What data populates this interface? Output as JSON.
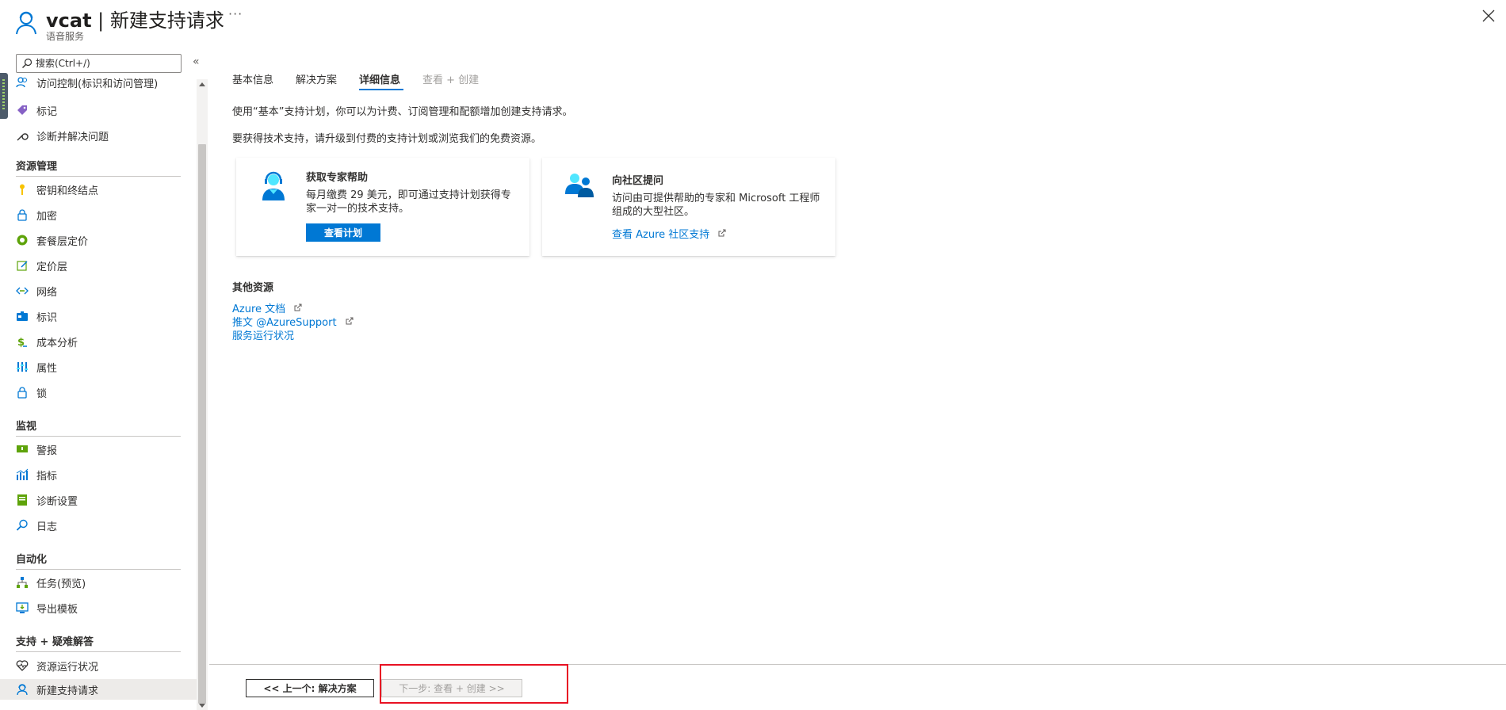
{
  "header": {
    "title_bold": "vcat",
    "title_rest": " | 新建支持请求",
    "subtitle": "语音服务",
    "more": "···"
  },
  "sidebar": {
    "search_placeholder": "搜索(Ctrl+/)",
    "collapse": "«",
    "items_top": [
      {
        "label": "访问控制(标识和访问管理)",
        "icon": "people-icon"
      },
      {
        "label": "标记",
        "icon": "tag-icon"
      },
      {
        "label": "诊断并解决问题",
        "icon": "wrench-icon"
      }
    ],
    "sections": [
      {
        "title": "资源管理",
        "items": [
          {
            "label": "密钥和终结点",
            "icon": "key-icon"
          },
          {
            "label": "加密",
            "icon": "lock-icon"
          },
          {
            "label": "套餐层定价",
            "icon": "pricing-icon"
          },
          {
            "label": "定价层",
            "icon": "edit-pricing-icon"
          },
          {
            "label": "网络",
            "icon": "network-icon"
          },
          {
            "label": "标识",
            "icon": "identity-icon"
          },
          {
            "label": "成本分析",
            "icon": "dollar-icon"
          },
          {
            "label": "属性",
            "icon": "properties-icon"
          },
          {
            "label": "锁",
            "icon": "lock-icon"
          }
        ]
      },
      {
        "title": "监视",
        "items": [
          {
            "label": "警报",
            "icon": "alert-icon"
          },
          {
            "label": "指标",
            "icon": "metrics-icon"
          },
          {
            "label": "诊断设置",
            "icon": "diagnostic-settings-icon"
          },
          {
            "label": "日志",
            "icon": "logs-icon"
          }
        ]
      },
      {
        "title": "自动化",
        "items": [
          {
            "label": "任务(预览)",
            "icon": "tasks-icon"
          },
          {
            "label": "导出模板",
            "icon": "export-template-icon"
          }
        ]
      },
      {
        "title": "支持 + 疑难解答",
        "items": [
          {
            "label": "资源运行状况",
            "icon": "heart-icon"
          },
          {
            "label": "新建支持请求",
            "icon": "support-icon"
          }
        ]
      }
    ]
  },
  "tabs": [
    {
      "label": "基本信息",
      "state": "normal"
    },
    {
      "label": "解决方案",
      "state": "normal"
    },
    {
      "label": "详细信息",
      "state": "active"
    },
    {
      "label": "查看 + 创建",
      "state": "disabled"
    }
  ],
  "main": {
    "line1": "使用“基本”支持计划，你可以为计费、订阅管理和配额增加创建支持请求。",
    "line2": "要获得技术支持，请升级到付费的支持计划或浏览我们的免费资源。",
    "card_expert": {
      "title": "获取专家帮助",
      "desc": "每月缴费 29 美元，即可通过支持计划获得专家一对一的技术支持。",
      "button": "查看计划"
    },
    "card_community": {
      "title": "向社区提问",
      "desc": "访问由可提供帮助的专家和 Microsoft 工程师组成的大型社区。",
      "link": "查看 Azure 社区支持"
    },
    "other_heading": "其他资源",
    "resources": [
      {
        "label": "Azure 文档",
        "external": true
      },
      {
        "label": "推文 @AzureSupport",
        "external": true
      },
      {
        "label": "服务运行状况",
        "external": false
      }
    ]
  },
  "footer": {
    "prev": "<< 上一个: 解决方案",
    "next": "下一步: 查看 + 创建 >>"
  },
  "colors": {
    "accent": "#0078d4",
    "highlight_box": "#e81123"
  }
}
